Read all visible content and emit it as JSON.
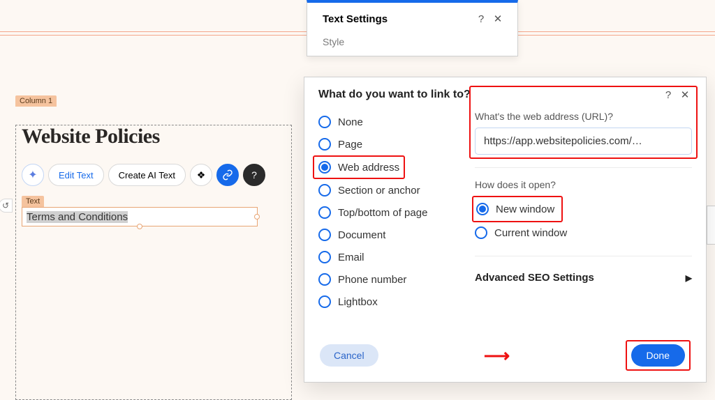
{
  "editor": {
    "column_label": "Column 1",
    "heading": "Website Policies",
    "sparkle_icon": "✦",
    "edit_text_label": "Edit Text",
    "create_ai_text_label": "Create AI Text",
    "paint_icon": "❖",
    "link_icon": "🔗",
    "help_icon": "?",
    "undo_icon": "↺",
    "text_label": "Text",
    "text_value": "Terms and Conditions"
  },
  "text_settings": {
    "title": "Text Settings",
    "help": "?",
    "close": "✕",
    "style_label": "Style"
  },
  "link_dialog": {
    "title": "What do you want to link to?",
    "help": "?",
    "close": "✕",
    "options": [
      "None",
      "Page",
      "Web address",
      "Section or anchor",
      "Top/bottom of page",
      "Document",
      "Email",
      "Phone number",
      "Lightbox"
    ],
    "selected_option_index": 2,
    "url_label": "What's the web address (URL)?",
    "url_value": "https://app.websitepolicies.com/…",
    "open_label": "How does it open?",
    "open_options": [
      "New window",
      "Current window"
    ],
    "open_selected_index": 0,
    "advanced_label": "Advanced SEO Settings",
    "advanced_arrow": "▶",
    "cancel_label": "Cancel",
    "done_label": "Done",
    "arrow_glyph": "⟶"
  }
}
